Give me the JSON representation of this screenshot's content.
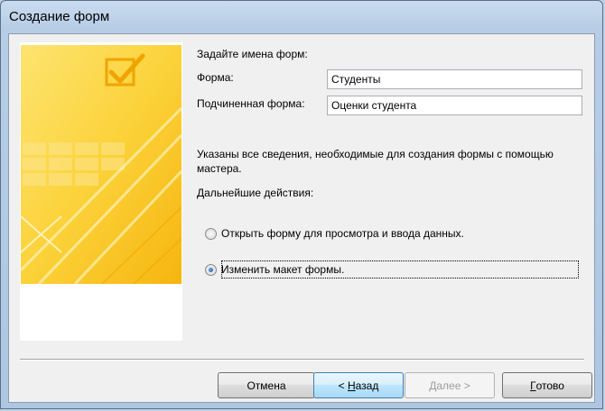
{
  "window": {
    "title": "Создание форм"
  },
  "form": {
    "prompt": "Задайте имена форм:",
    "form_label": "Форма:",
    "form_value": "Студенты",
    "subform_label": "Подчиненная форма:",
    "subform_value": "Оценки студента"
  },
  "info": {
    "message": "Указаны все сведения, необходимые для создания формы с помощью мастера.",
    "next_actions_label": "Дальнейшие действия:"
  },
  "options": [
    {
      "label": "Открыть форму для просмотра и ввода данных.",
      "checked": false
    },
    {
      "label": "Изменить макет формы.",
      "checked": true
    }
  ],
  "buttons": {
    "cancel": "Отмена",
    "back_prefix": "< ",
    "back_accel": "Н",
    "back_rest": "азад",
    "next": "Далее >",
    "finish_accel": "Г",
    "finish_rest": "отово"
  },
  "colors": {
    "graphic_yellow": "#f9c416",
    "graphic_light": "#fde98a",
    "accent_blue": "#3c7fb1"
  }
}
